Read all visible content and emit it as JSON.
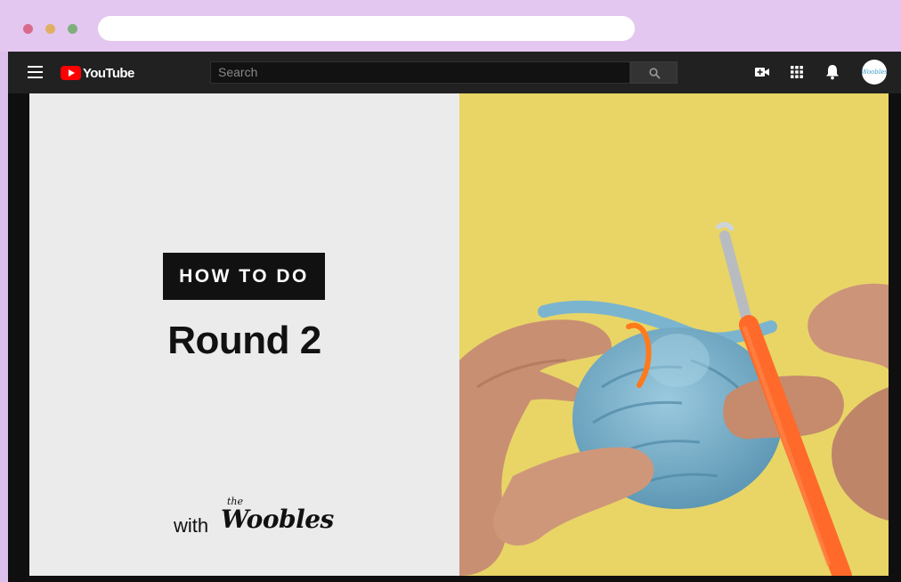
{
  "header": {
    "logo_text": "YouTube",
    "search_placeholder": "Search"
  },
  "video": {
    "badge_text": "HOW TO DO",
    "title": "Round 2",
    "brand_prefix": "with",
    "brand_small": "the",
    "brand_name": "Woobles",
    "avatar_text": "Woobles"
  },
  "colors": {
    "youtube_red": "#ff0000",
    "header_bg": "#212121",
    "yarn_blue": "#7bb4cf",
    "hook_orange": "#ff6a2a",
    "backdrop_yellow": "#ecd96a"
  }
}
